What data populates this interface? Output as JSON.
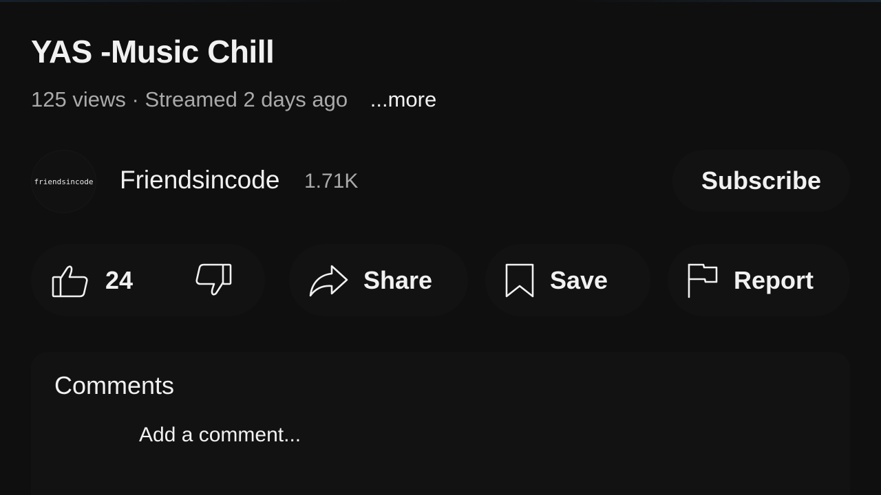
{
  "video": {
    "title": "YAS -Music Chill",
    "views": "125 views",
    "separator": "·",
    "streamed": "Streamed 2 days ago",
    "more_label": "...more"
  },
  "channel": {
    "avatar_text": "friendsincode",
    "name": "Friendsincode",
    "subscriber_count": "1.71K",
    "subscribe_label": "Subscribe"
  },
  "actions": {
    "like_icon": "thumbs-up-icon",
    "like_count": "24",
    "dislike_icon": "thumbs-down-icon",
    "share_icon": "share-arrow-icon",
    "share_label": "Share",
    "save_icon": "bookmark-icon",
    "save_label": "Save",
    "report_icon": "flag-icon",
    "report_label": "Report"
  },
  "comments": {
    "title": "Comments",
    "placeholder": "Add a comment..."
  },
  "colors": {
    "background": "#0f0f0f",
    "surface": "#121212",
    "text_primary": "#f1f1f1",
    "text_secondary": "#aaaaaa"
  }
}
